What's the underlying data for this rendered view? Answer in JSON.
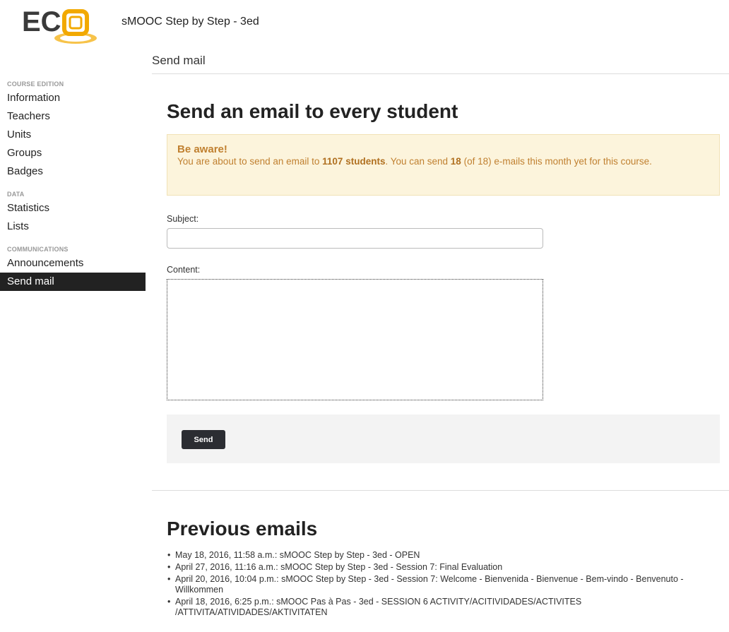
{
  "header": {
    "logo_text": "ECO",
    "course_title": "sMOOC Step by Step - 3ed"
  },
  "sidebar": {
    "sections": [
      {
        "heading": "COURSE EDITION",
        "items": [
          "Information",
          "Teachers",
          "Units",
          "Groups",
          "Badges"
        ]
      },
      {
        "heading": "DATA",
        "items": [
          "Statistics",
          "Lists"
        ]
      },
      {
        "heading": "COMMUNICATIONS",
        "items": [
          "Announcements",
          "Send mail"
        ]
      }
    ],
    "active_item": "Send mail"
  },
  "page": {
    "subtitle": "Send mail",
    "heading": "Send an email to every student"
  },
  "alert": {
    "title": "Be aware!",
    "text_1": "You are about to send an email to ",
    "students": "1107 students",
    "text_2": ". You can send ",
    "remaining": "18",
    "text_3": " (of 18) e-mails this month yet for this course."
  },
  "form": {
    "subject_label": "Subject:",
    "subject_value": "",
    "content_label": "Content:",
    "content_value": "",
    "send_label": "Send"
  },
  "previous": {
    "heading": "Previous emails",
    "items": [
      "May 18, 2016, 11:58 a.m.: sMOOC Step by Step - 3ed - OPEN",
      "April 27, 2016, 11:16 a.m.: sMOOC Step by Step - 3ed - Session 7: Final Evaluation",
      "April 20, 2016, 10:04 p.m.: sMOOC Step by Step - 3ed - Session 7: Welcome - Bienvenida - Bienvenue - Bem-vindo - Benvenuto - Willkommen",
      "April 18, 2016, 6:25 p.m.: sMOOC Pas à Pas - 3ed - SESSION 6 ACTIVITY/ACITIVIDADES/ACTIVITES /ATTIVITA/ATIVIDADES/AKTIVITATEN"
    ]
  },
  "colors": {
    "logo_dark": "#3a3a3a",
    "logo_orange": "#f2a900",
    "alert_bg": "#fcf4dc",
    "alert_text": "#c08030",
    "sidebar_active_bg": "#222222"
  }
}
